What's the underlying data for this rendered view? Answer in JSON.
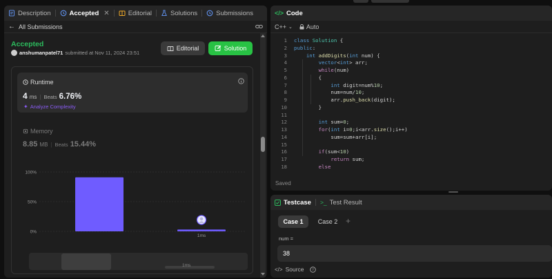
{
  "left_tabs": {
    "description": "Description",
    "accepted": "Accepted",
    "editorial": "Editorial",
    "solutions": "Solutions",
    "submissions": "Submissions"
  },
  "back_label": "All Submissions",
  "submission": {
    "status": "Accepted",
    "user": "anshumanpatel71",
    "submitted_text": "submitted at Nov 11, 2024 23:51",
    "editorial_button": "Editorial",
    "solution_button": "Solution"
  },
  "runtime": {
    "title": "Runtime",
    "value": "4",
    "unit": "ms",
    "beats_label": "Beats",
    "beats_value": "6.76%",
    "analyze": "Analyze Complexity"
  },
  "memory": {
    "title": "Memory",
    "value": "8.85",
    "unit": "MB",
    "beats_label": "Beats",
    "beats_value": "15.44%"
  },
  "chart_data": {
    "type": "bar",
    "y_ticks": [
      "100%",
      "50%",
      "0%"
    ],
    "ylim": [
      0,
      100
    ],
    "categories": [
      "",
      "1ms"
    ],
    "values": [
      91,
      3
    ],
    "colors": [
      "#6f5cff",
      "#6f5cff"
    ],
    "mini_label": "1ms"
  },
  "code_panel": {
    "title": "Code",
    "language": "C++",
    "mode": "Auto",
    "saved": "Saved"
  },
  "code_lines": [
    {
      "n": "1",
      "t": "class Solution {"
    },
    {
      "n": "2",
      "t": "public:"
    },
    {
      "n": "3",
      "t": "    int addDigits(int num) {"
    },
    {
      "n": "4",
      "t": "        vector<int> arr;"
    },
    {
      "n": "5",
      "t": "        while(num)"
    },
    {
      "n": "6",
      "t": "        {"
    },
    {
      "n": "7",
      "t": "            int digit=num%10;"
    },
    {
      "n": "8",
      "t": "            num=num/10;"
    },
    {
      "n": "9",
      "t": "            arr.push_back(digit);"
    },
    {
      "n": "10",
      "t": "        }"
    },
    {
      "n": "11",
      "t": ""
    },
    {
      "n": "12",
      "t": "        int sum=0;"
    },
    {
      "n": "13",
      "t": "        for(int i=0;i<arr.size();i++)"
    },
    {
      "n": "14",
      "t": "            sum=sum+arr[i];"
    },
    {
      "n": "15",
      "t": ""
    },
    {
      "n": "16",
      "t": "        if(sum<10)"
    },
    {
      "n": "17",
      "t": "            return sum;"
    },
    {
      "n": "18",
      "t": "        else"
    }
  ],
  "testcase_panel": {
    "testcase_tab": "Testcase",
    "result_tab": "Test Result",
    "case1": "Case 1",
    "case2": "Case 2",
    "add": "+",
    "var_label": "num =",
    "var_value": "38",
    "source": "Source"
  }
}
